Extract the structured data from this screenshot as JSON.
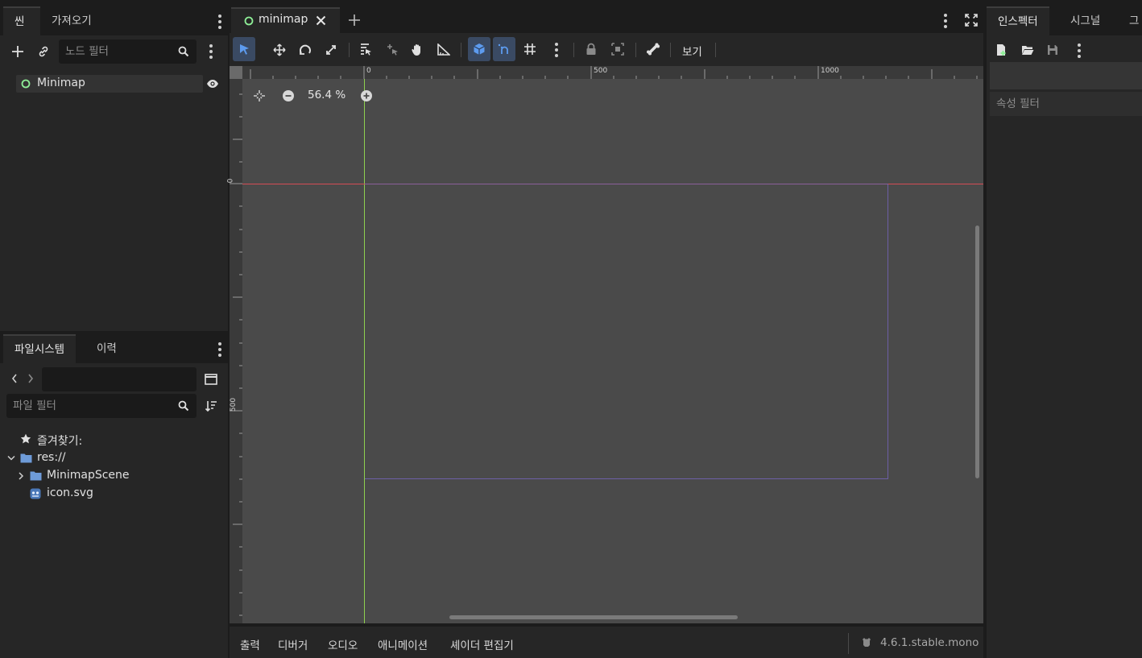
{
  "scene_dock": {
    "tabs": [
      "씬",
      "가져오기"
    ],
    "filter_placeholder": "노드 필터",
    "root_node": "Minimap"
  },
  "filesystem_dock": {
    "tabs": [
      "파일시스템",
      "이력"
    ],
    "path_value": "",
    "filter_placeholder": "파일 필터",
    "favorites_label": "즐겨찾기:",
    "items": [
      {
        "name": "res://",
        "type": "folder",
        "expanded": true
      },
      {
        "name": "MinimapScene",
        "type": "folder",
        "expanded": false
      },
      {
        "name": "icon.svg",
        "type": "file"
      }
    ]
  },
  "editor": {
    "scene_tab": "minimap",
    "view_menu": "보기",
    "zoom": "56.4 %",
    "ruler_top_labels": [
      "0",
      "500",
      "1000"
    ],
    "ruler_left_labels": [
      "0",
      "500"
    ]
  },
  "bottom_panel": {
    "tabs": [
      "출력",
      "디버거",
      "오디오",
      "애니메이션",
      "셰이더 편집기"
    ],
    "version": "4.6.1.stable.mono"
  },
  "inspector_dock": {
    "tabs": [
      "인스펙터",
      "시그널",
      "그"
    ],
    "filter_placeholder": "속성 필터"
  },
  "colors": {
    "accent_blue": "#5d9bee",
    "node_green": "#8eef97",
    "x_axis": "#d44c55",
    "y_axis": "#8fd14f",
    "frame_rect": "#6d5fa6"
  }
}
